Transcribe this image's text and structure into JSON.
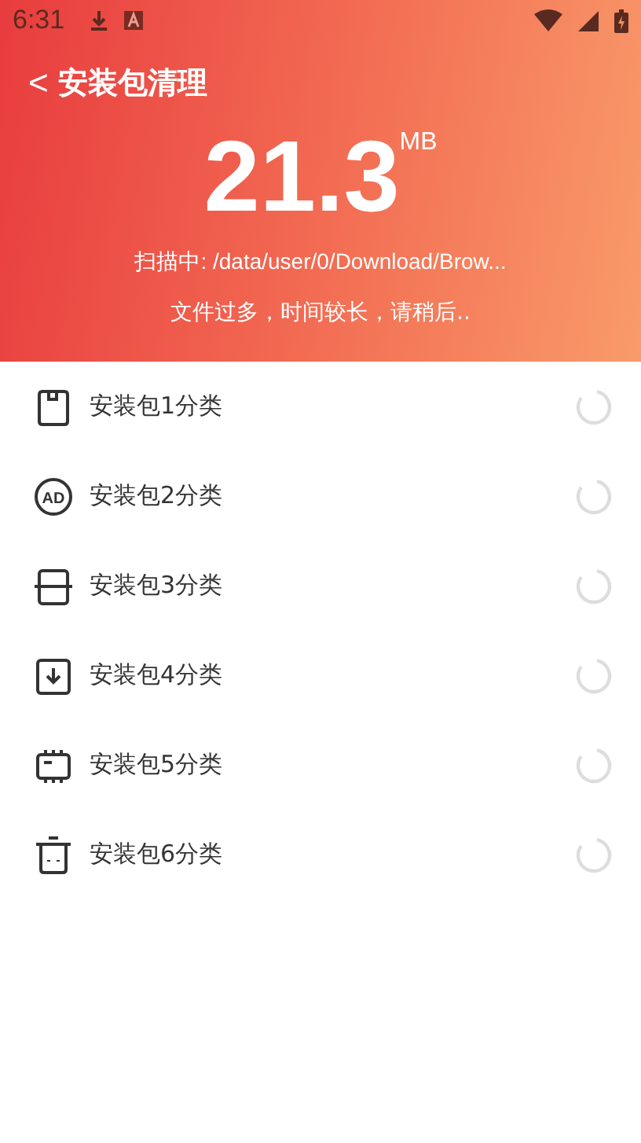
{
  "status_bar": {
    "time": "6:31"
  },
  "header": {
    "title": "安装包清理",
    "back": "<",
    "size": "21.3",
    "unit": "MB",
    "scanning": "扫描中: /data/user/0/Download/Brow...",
    "note": "文件过多，时间较长，请稍后.."
  },
  "categories": [
    {
      "kind": "sd",
      "label": "安装包1分类"
    },
    {
      "kind": "ad",
      "label": "安装包2分类",
      "icon_text": "AD"
    },
    {
      "kind": "card",
      "label": "安装包3分类"
    },
    {
      "kind": "download",
      "label": "安装包4分类"
    },
    {
      "kind": "chip",
      "label": "安装包5分类"
    },
    {
      "kind": "trash",
      "label": "安装包6分类"
    }
  ]
}
